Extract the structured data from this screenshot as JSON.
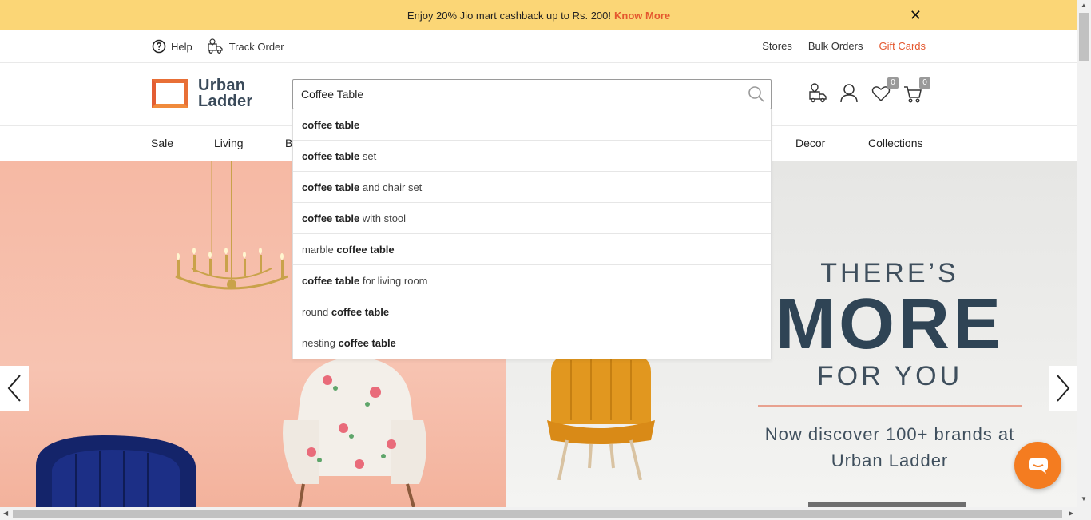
{
  "promo": {
    "text": "Enjoy 20% Jio mart cashback up to Rs. 200!",
    "link": "Know More",
    "close": "✕"
  },
  "utility": {
    "help": "Help",
    "track_order": "Track Order",
    "stores": "Stores",
    "bulk_orders": "Bulk Orders",
    "gift_cards": "Gift Cards"
  },
  "logo": {
    "line1": "Urban",
    "line2": "Ladder"
  },
  "search": {
    "value": "Coffee Table",
    "placeholder": ""
  },
  "header_icons": {
    "wishlist_count": "0",
    "cart_count": "0"
  },
  "nav": {
    "items": [
      "Sale",
      "Living",
      "B",
      "Decor",
      "Collections"
    ]
  },
  "suggestions": [
    {
      "bold_prefix": "coffee table",
      "suffix": "",
      "plain_prefix": ""
    },
    {
      "bold_prefix": "coffee table",
      "suffix": " set",
      "plain_prefix": ""
    },
    {
      "bold_prefix": "coffee table",
      "suffix": " and chair set",
      "plain_prefix": ""
    },
    {
      "bold_prefix": "coffee table",
      "suffix": " with stool",
      "plain_prefix": ""
    },
    {
      "plain_prefix": "marble ",
      "bold_prefix": "coffee table",
      "suffix": ""
    },
    {
      "bold_prefix": "coffee table",
      "suffix": " for living room",
      "plain_prefix": ""
    },
    {
      "plain_prefix": "round ",
      "bold_prefix": "coffee table",
      "suffix": ""
    },
    {
      "plain_prefix": "nesting ",
      "bold_prefix": "coffee table",
      "suffix": ""
    }
  ],
  "hero": {
    "line1": "THERE’S",
    "line2": "MORE",
    "line3": "FOR YOU",
    "line4": "Now discover 100+ brands at",
    "line5": "Urban Ladder"
  },
  "colors": {
    "promo_bg": "#fbd676",
    "accent": "#e4572e",
    "chat": "#f47c20",
    "logo": "#e86f36"
  },
  "icons": [
    "help-icon",
    "track-order-icon",
    "search-icon",
    "store-locator-icon",
    "profile-icon",
    "wishlist-icon",
    "cart-icon",
    "chevron-left-icon",
    "chevron-right-icon",
    "chat-icon",
    "close-icon"
  ]
}
